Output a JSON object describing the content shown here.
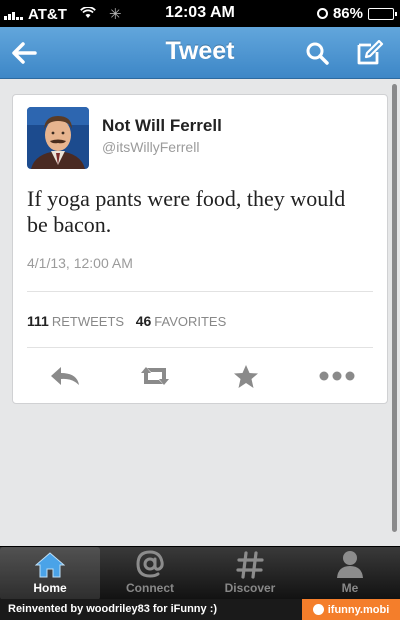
{
  "status_bar": {
    "carrier": "AT&T",
    "time": "12:03 AM",
    "battery_percent": "86%",
    "battery_level": 0.86,
    "icons": [
      "signal-icon",
      "wifi-icon",
      "activity-spinner-icon",
      "alarm-icon",
      "battery-icon"
    ]
  },
  "nav": {
    "title": "Tweet",
    "back_icon": "back-arrow-icon",
    "search_icon": "search-icon",
    "compose_icon": "compose-icon",
    "bar_color": "#4a92d0"
  },
  "tweet": {
    "author_name": "Not Will Ferrell",
    "author_handle": "@itsWillyFerrell",
    "text": "If yoga pants were food, they would be bacon.",
    "timestamp": "4/1/13, 12:00 AM",
    "retweet_count": "111",
    "retweet_label": "RETWEETS",
    "favorite_count": "46",
    "favorite_label": "FAVORITES",
    "actions": [
      "reply-icon",
      "retweet-icon",
      "favorite-star-icon",
      "more-icon"
    ]
  },
  "tabs": [
    {
      "label": "Home",
      "icon": "home-icon",
      "active": true
    },
    {
      "label": "Connect",
      "icon": "at-sign-icon",
      "active": false
    },
    {
      "label": "Discover",
      "icon": "hashtag-icon",
      "active": false
    },
    {
      "label": "Me",
      "icon": "person-icon",
      "active": false
    }
  ],
  "colors": {
    "tab_active_icon": "#4aa3e8",
    "footer_brand": "#f47e2b"
  },
  "footer": {
    "credit": "Reinvented by woodriley83 for iFunny :)",
    "brand": "ifunny.mobi"
  }
}
